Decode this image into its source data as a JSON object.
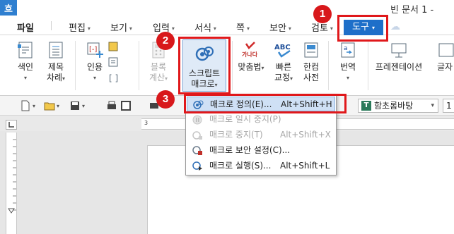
{
  "app": {
    "icon_glyph": "흐",
    "doc_title": "빈 문서 1 -"
  },
  "menu": {
    "file": "파일",
    "items": [
      "편집",
      "보기",
      "입력",
      "서식",
      "쪽",
      "보안",
      "검토"
    ],
    "tool_tab": "도구",
    "dropdown_arrow": "▾"
  },
  "ribbon": {
    "index": {
      "line1": "색인",
      "line2": ""
    },
    "toc": {
      "line1": "제목",
      "line2": "차례"
    },
    "quote": {
      "line1": "인용",
      "line2": ""
    },
    "block_calc": {
      "line1": "블록",
      "line2": "계산"
    },
    "script_macro": {
      "line1": "스크립트",
      "line2": "매크로"
    },
    "spellcheck": {
      "line1": "맞춤법",
      "line2": ""
    },
    "quick_correct": {
      "line1": "빠른",
      "line2": "교정"
    },
    "hancom_dict": {
      "line1": "한컴",
      "line2": "사전"
    },
    "translate": {
      "line1": "번역",
      "line2": ""
    },
    "presentation": {
      "line1": "프레젠테이션",
      "line2": ""
    },
    "glyph": {
      "line1": "글자",
      "line2": ""
    },
    "spell_icon_text": "가나다",
    "abc_icon_text": "ABC"
  },
  "toolbar2": {
    "font_name": "함초롬바탕",
    "font_size": "1"
  },
  "ruler": {
    "mark": "3"
  },
  "dropdown": {
    "items": [
      {
        "label": "매크로 정의(E)...",
        "shortcut": "Alt+Shift+H",
        "enabled": true,
        "highlighted": true
      },
      {
        "label": "매크로 일시 중지(P)",
        "shortcut": "",
        "enabled": false,
        "highlighted": false
      },
      {
        "label": "매크로 중지(T)",
        "shortcut": "Alt+Shift+X",
        "enabled": false,
        "highlighted": false
      },
      {
        "label": "매크로 보안 설정(C)...",
        "shortcut": "",
        "enabled": true,
        "highlighted": false
      },
      {
        "label": "매크로 실행(S)...",
        "shortcut": "Alt+Shift+L",
        "enabled": true,
        "highlighted": false
      }
    ]
  },
  "callouts": [
    "1",
    "2",
    "3"
  ],
  "colors": {
    "accent": "#1e6fc9",
    "callout_red": "#e0181b",
    "highlight": "#cfe0f5"
  }
}
